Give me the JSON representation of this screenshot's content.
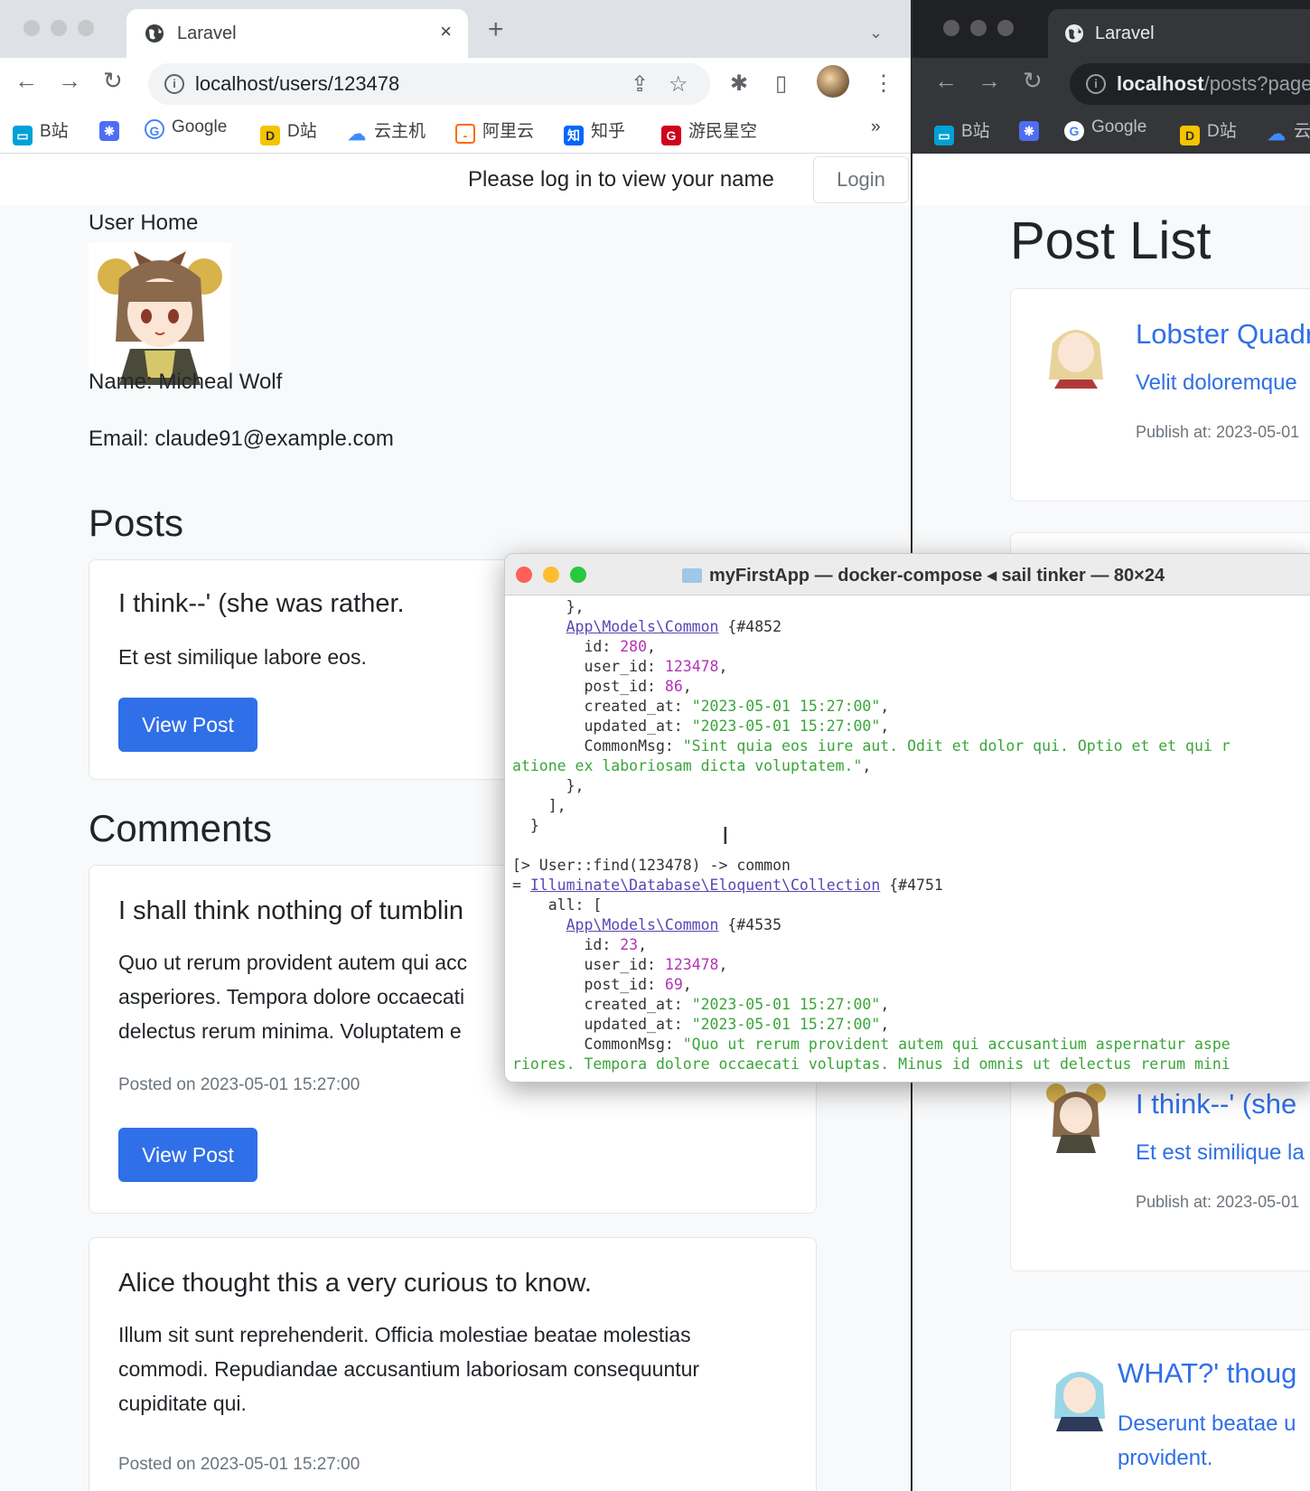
{
  "left_browser": {
    "tab_title": "Laravel",
    "new_tab": "+",
    "url": "localhost/users/123478",
    "bookmarks": [
      {
        "label": "B站",
        "icon": "bilibili-icon",
        "color": "#00a1d6"
      },
      {
        "label": "",
        "icon": "paw-icon",
        "color": "#4e6ef2"
      },
      {
        "label": "Google",
        "icon": "google-icon",
        "color": "#4285f4"
      },
      {
        "label": "D站",
        "icon": "d-site-icon",
        "color": "#f5c400"
      },
      {
        "label": "云主机",
        "icon": "cloud-icon",
        "color": "#3d8bff"
      },
      {
        "label": "阿里云",
        "icon": "aliyun-icon",
        "color": "#ff6a00"
      },
      {
        "label": "知乎",
        "icon": "zhihu-icon",
        "color": "#0066ff"
      },
      {
        "label": "游民星空",
        "icon": "gamersky-icon",
        "color": "#d0021b"
      }
    ],
    "more": "»",
    "page": {
      "login_message": "Please log in to view your name",
      "login_button": "Login",
      "user_home": "User Home",
      "name_line": "Name: Micheal Wolf",
      "email_line": "Email: claude91@example.com",
      "posts_heading": "Posts",
      "post": {
        "title": "I think--' (she was rather.",
        "body": "Et est similique labore eos.",
        "button": "View Post"
      },
      "comments_heading": "Comments",
      "comments": [
        {
          "title": "I shall think nothing of tumblin",
          "body_lines": [
            "Quo ut rerum provident autem qui acc",
            "asperiores. Tempora dolore occaecati",
            "delectus rerum minima. Voluptatem e"
          ],
          "meta": "Posted on 2023-05-01 15:27:00",
          "button": "View Post"
        },
        {
          "title": "Alice thought this a very curious to know.",
          "body_lines": [
            "Illum sit sunt reprehenderit. Officia molestiae beatae molestias",
            "commodi. Repudiandae accusantium laboriosam consequuntur",
            "cupiditate qui."
          ],
          "meta": "Posted on 2023-05-01 15:27:00"
        }
      ]
    }
  },
  "right_browser": {
    "tab_title": "Laravel",
    "url_bold": "localhost",
    "url_rest": "/posts?page",
    "bookmarks": [
      "B站",
      "",
      "Google",
      "D站",
      "云"
    ],
    "page": {
      "heading": "Post List",
      "posts": [
        {
          "title": "Lobster Quadr",
          "sub": "Velit doloremque",
          "meta": "Publish at: 2023-05-01"
        },
        {
          "title": "I think--' (she",
          "sub": "Et est similique la",
          "meta": "Publish at: 2023-05-01"
        },
        {
          "title": "WHAT?' thoug",
          "sub": "Deserunt beatae u",
          "sub2": "provident."
        }
      ]
    }
  },
  "terminal": {
    "title": "myFirstApp — docker-compose ◂ sail tinker — 80×24",
    "lines": [
      [
        {
          "t": "      },"
        }
      ],
      [
        {
          "t": "      "
        },
        {
          "t": "App\\Models\\Common",
          "c": "cls"
        },
        {
          "t": " {#4852"
        }
      ],
      [
        {
          "t": "        id: "
        },
        {
          "t": "280",
          "c": "num"
        },
        {
          "t": ","
        }
      ],
      [
        {
          "t": "        user_id: "
        },
        {
          "t": "123478",
          "c": "num"
        },
        {
          "t": ","
        }
      ],
      [
        {
          "t": "        post_id: "
        },
        {
          "t": "86",
          "c": "num"
        },
        {
          "t": ","
        }
      ],
      [
        {
          "t": "        created_at: "
        },
        {
          "t": "\"2023-05-01 15:27:00\"",
          "c": "str"
        },
        {
          "t": ","
        }
      ],
      [
        {
          "t": "        updated_at: "
        },
        {
          "t": "\"2023-05-01 15:27:00\"",
          "c": "str"
        },
        {
          "t": ","
        }
      ],
      [
        {
          "t": "        CommonMsg: "
        },
        {
          "t": "\"Sint quia eos iure aut. Odit et dolor qui. Optio et et qui r",
          "c": "str"
        }
      ],
      [
        {
          "t": "atione ex laboriosam dicta voluptatem.\"",
          "c": "str"
        },
        {
          "t": ","
        }
      ],
      [
        {
          "t": "      },"
        }
      ],
      [
        {
          "t": "    ],"
        }
      ],
      [
        {
          "t": "  }"
        }
      ],
      [
        {
          "t": ""
        }
      ],
      [
        {
          "t": "[> User::find(123478) -> common"
        }
      ],
      [
        {
          "t": "= "
        },
        {
          "t": "Illuminate\\Database\\Eloquent\\Collection",
          "c": "cls"
        },
        {
          "t": " {#4751"
        }
      ],
      [
        {
          "t": "    all: ["
        }
      ],
      [
        {
          "t": "      "
        },
        {
          "t": "App\\Models\\Common",
          "c": "cls"
        },
        {
          "t": " {#4535"
        }
      ],
      [
        {
          "t": "        id: "
        },
        {
          "t": "23",
          "c": "num"
        },
        {
          "t": ","
        }
      ],
      [
        {
          "t": "        user_id: "
        },
        {
          "t": "123478",
          "c": "num"
        },
        {
          "t": ","
        }
      ],
      [
        {
          "t": "        post_id: "
        },
        {
          "t": "69",
          "c": "num"
        },
        {
          "t": ","
        }
      ],
      [
        {
          "t": "        created_at: "
        },
        {
          "t": "\"2023-05-01 15:27:00\"",
          "c": "str"
        },
        {
          "t": ","
        }
      ],
      [
        {
          "t": "        updated_at: "
        },
        {
          "t": "\"2023-05-01 15:27:00\"",
          "c": "str"
        },
        {
          "t": ","
        }
      ],
      [
        {
          "t": "        CommonMsg: "
        },
        {
          "t": "\"Quo ut rerum provident autem qui accusantium aspernatur aspe",
          "c": "str"
        }
      ],
      [
        {
          "t": "riores. Tempora dolore occaecati voluptas. Minus id omnis ut delectus rerum mini",
          "c": "str"
        }
      ]
    ]
  }
}
